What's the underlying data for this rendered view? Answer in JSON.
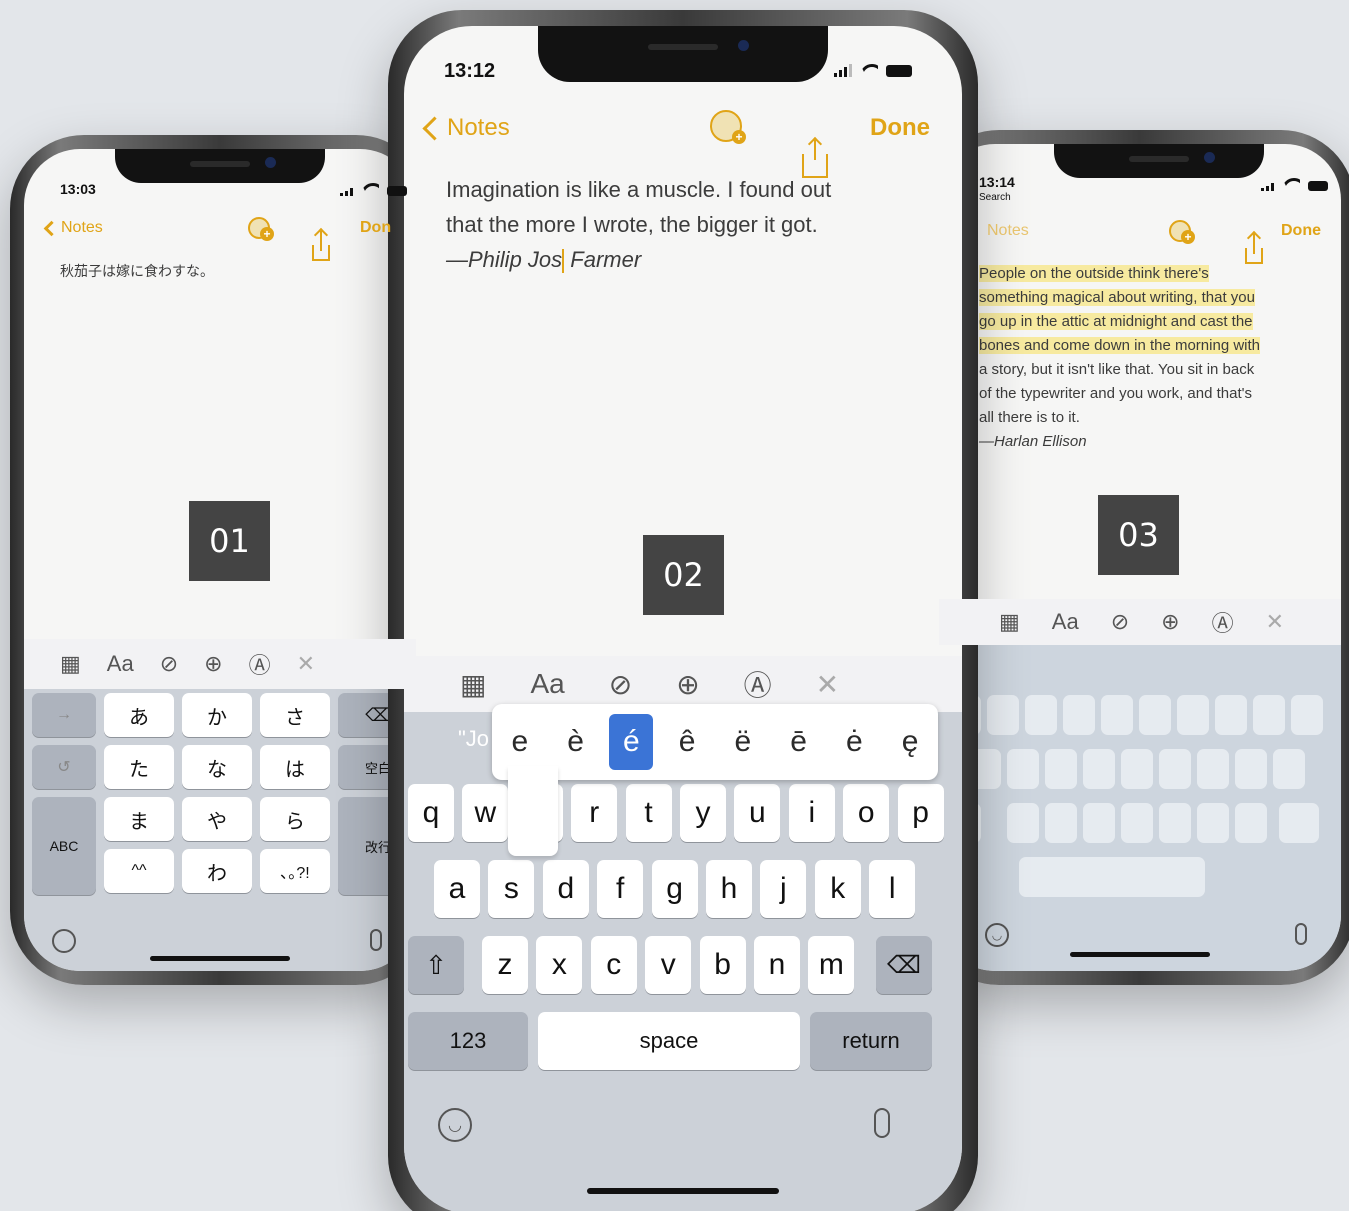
{
  "labels": {
    "one": "01",
    "two": "02",
    "three": "03"
  },
  "phone_left": {
    "status_time": "13:03",
    "nav": {
      "back": "Notes",
      "done": "Don"
    },
    "note_text": "秋茄子は嫁に食わすな。",
    "toolbar": {
      "table": "▦",
      "format": "Aa",
      "check": "⊘",
      "add": "⊕",
      "markup": "Ⓐ",
      "close": "✕"
    },
    "kana_keys": [
      "あ",
      "か",
      "さ",
      "た",
      "な",
      "は",
      "ま",
      "や",
      "ら",
      "^^",
      "わ",
      "､｡?!"
    ],
    "side_keys": {
      "arrow": "→",
      "undo": "↺",
      "abc": "ABC",
      "delete": "⌫",
      "space": "空白",
      "return": "改行"
    }
  },
  "phone_center": {
    "status_time": "13:12",
    "nav": {
      "back": "Notes",
      "done": "Done"
    },
    "note_line1": "Imagination is like a muscle. I found out",
    "note_line2": "that the more I wrote, the bigger it got.",
    "note_line3a": "—Philip Jos",
    "note_line3b": " Farmer",
    "toolbar": {
      "table": "▦",
      "format": "Aa",
      "check": "⊘",
      "add": "⊕",
      "markup": "Ⓐ",
      "close": "✕"
    },
    "suggestion": "\"Jo",
    "popup_accents": [
      "e",
      "è",
      "é",
      "ê",
      "ë",
      "ē",
      "ė",
      "ę"
    ],
    "row1": [
      "q",
      "w",
      "",
      "r",
      "t",
      "y",
      "u",
      "i",
      "o",
      "p"
    ],
    "row2": [
      "a",
      "s",
      "d",
      "f",
      "g",
      "h",
      "j",
      "k",
      "l"
    ],
    "row3": [
      "z",
      "x",
      "c",
      "v",
      "b",
      "n",
      "m"
    ],
    "bottom": {
      "numbers": "123",
      "space": "space",
      "return": "return",
      "shift": "⇧",
      "delete": "⌫"
    }
  },
  "phone_right": {
    "status_time": "13:14",
    "status_sub": "Search",
    "nav": {
      "back": "Notes",
      "done": "Done"
    },
    "lines": [
      "People on the outside think there's",
      "something magical about writing, that you",
      "go up in the attic at midnight and cast the",
      "bones and come down in the morning with",
      "a story, but it isn't like that. You sit in back",
      "of the typewriter and you work, and that's",
      "all there is to it.",
      "—Harlan Ellison"
    ],
    "toolbar": {
      "table": "▦",
      "format": "Aa",
      "check": "⊘",
      "add": "⊕",
      "markup": "Ⓐ",
      "close": "✕"
    }
  },
  "colors": {
    "accent": "#e0a417",
    "selected_key": "#3b74d6",
    "keyboard_bg": "#ccd1d8"
  }
}
